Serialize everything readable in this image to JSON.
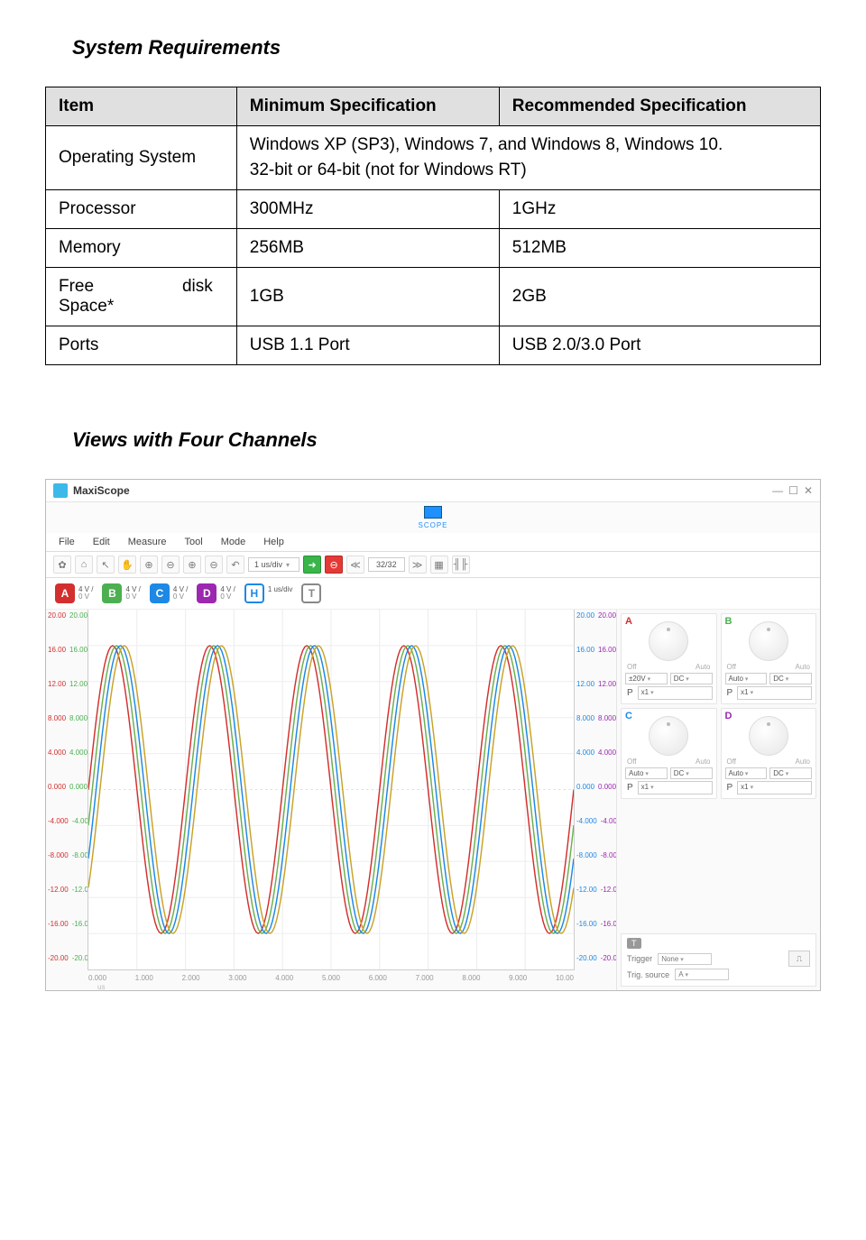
{
  "heading1": "System Requirements",
  "heading2": "Views with Four Channels",
  "table": {
    "h_item": "Item",
    "h_min": "Minimum Specification",
    "h_rec": "Recommended Specification",
    "os_label": "Operating System",
    "os_line1": "Windows XP (SP3), Windows 7, and Windows 8, Windows 10.",
    "os_line2": "32-bit or 64-bit (not for Windows RT)",
    "proc_label": "Processor",
    "proc_min": "300MHz",
    "proc_rec": "1GHz",
    "mem_label": "Memory",
    "mem_min": "256MB",
    "mem_rec": "512MB",
    "disk_w1": "Free",
    "disk_w2": "disk",
    "disk_w3": "Space*",
    "disk_min": "1GB",
    "disk_rec": "2GB",
    "ports_label": "Ports",
    "ports_min": "USB 1.1 Port",
    "ports_rec": "USB 2.0/3.0 Port"
  },
  "app": {
    "title": "MaxiScope",
    "scope_label": "SCOPE",
    "menu": {
      "file": "File",
      "edit": "Edit",
      "measure": "Measure",
      "tool": "Tool",
      "mode": "Mode",
      "help": "Help"
    },
    "toolbar": {
      "gear": "✿",
      "home": "⌂",
      "arrow": "↖",
      "hand": "✋",
      "zin": "⊕",
      "zout": "⊖",
      "z3": "⊕",
      "z4": "⊖",
      "undo": "↶",
      "timediv": "1 us/div",
      "go": "➜",
      "stop": "⊖",
      "rew": "≪",
      "buf": "32/32",
      "fwd": "≫",
      "i1": "▦",
      "i2": "╢╟"
    },
    "chan": {
      "A": "A",
      "B": "B",
      "C": "C",
      "D": "D",
      "H": "H",
      "T": "T",
      "vdiv": "4 V /",
      "zero": "0 V",
      "hdiv": "1 us/div"
    },
    "axis": {
      "left": [
        "20.00",
        "16.00",
        "12.00",
        "8.000",
        "4.000",
        "0.000",
        "-4.000",
        "-8.000",
        "-12.00",
        "-16.00",
        "-20.00"
      ],
      "right": [
        "20.00",
        "16.00",
        "12.00",
        "8.000",
        "4.000",
        "0.000",
        "-4.000",
        "-8.000",
        "-12.00",
        "-16.00",
        "-20.00"
      ],
      "x": [
        "0.000",
        "1.000",
        "2.000",
        "3.000",
        "4.000",
        "5.000",
        "6.000",
        "7.000",
        "8.000",
        "9.000",
        "10.00"
      ],
      "xunit": "us"
    },
    "panel": {
      "off": "Off",
      "auto": "Auto",
      "dc": "DC",
      "autoL": "Auto",
      "p": "P",
      "x1": "x1",
      "p20v": "±20V",
      "trig_tag": "T",
      "trig_label": "Trigger",
      "trig_none": "None",
      "trig_src_label": "Trig. source",
      "trig_src": "A"
    }
  }
}
